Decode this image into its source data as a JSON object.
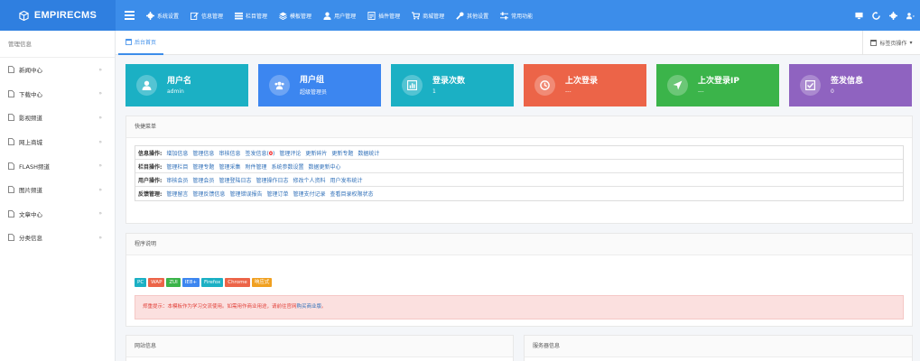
{
  "app": {
    "logo": "EMPIRECMS"
  },
  "nav": [
    {
      "label": "系统设置",
      "icon": "gear-icon"
    },
    {
      "label": "信息管理",
      "icon": "edit-icon"
    },
    {
      "label": "栏目管理",
      "icon": "list-icon"
    },
    {
      "label": "模板管理",
      "icon": "layers-icon"
    },
    {
      "label": "用户管理",
      "icon": "user-icon"
    },
    {
      "label": "插件管理",
      "icon": "plugin-icon"
    },
    {
      "label": "商城管理",
      "icon": "cart-icon"
    },
    {
      "label": "其他设置",
      "icon": "wrench-icon"
    },
    {
      "label": "常用功能",
      "icon": "sliders-icon"
    }
  ],
  "sidebar": {
    "title": "管理信息",
    "items": [
      {
        "label": "新闻中心"
      },
      {
        "label": "下载中心"
      },
      {
        "label": "影视频道"
      },
      {
        "label": "网上商城"
      },
      {
        "label": "FLASH频道"
      },
      {
        "label": "图片频道"
      },
      {
        "label": "文章中心"
      },
      {
        "label": "分类信息"
      }
    ]
  },
  "tabs": {
    "home": "后台首页",
    "ops": "标签页操作"
  },
  "cards": [
    {
      "title": "用户名",
      "value": "admin",
      "color": "#1bb0c4",
      "icon": "user-icon"
    },
    {
      "title": "用户组",
      "value": "超级管理员",
      "color": "#3c86f0",
      "icon": "users-icon"
    },
    {
      "title": "登录次数",
      "value": "1",
      "color": "#1bb0c4",
      "icon": "chart-icon"
    },
    {
      "title": "上次登录",
      "value": "---",
      "color": "#ec6448",
      "icon": "clock-icon"
    },
    {
      "title": "上次登录IP",
      "value": "---",
      "color": "#3bb44a",
      "icon": "location-arrow-icon"
    },
    {
      "title": "签发信息",
      "value": "0",
      "color": "#8f63c0",
      "icon": "checkbox-icon"
    }
  ],
  "quick_menu": {
    "title": "快捷菜单",
    "rows": [
      {
        "label": "信息操作:",
        "links": [
          "增加信息",
          "管理信息",
          "审核信息",
          "签发信息",
          "管理评论",
          "更新碎片",
          "更新专题",
          "数据统计"
        ],
        "signed_count": "0"
      },
      {
        "label": "栏目操作:",
        "links": [
          "管理栏目",
          "管理专题",
          "管理采集",
          "附件管理",
          "系统参数设置",
          "数据更新中心"
        ]
      },
      {
        "label": "用户操作:",
        "links": [
          "审核会员",
          "管理会员",
          "管理登陆日志",
          "管理操作日志",
          "修改个人资料",
          "用户发布统计"
        ]
      },
      {
        "label": "反馈管理:",
        "links": [
          "管理留言",
          "管理反馈信息",
          "管理错误报告",
          "管理订单",
          "管理支付记录",
          "查看目录权限状态"
        ]
      }
    ]
  },
  "program": {
    "title": "程序说明",
    "badges": [
      {
        "text": "PC",
        "color": "#1bb0c4"
      },
      {
        "text": "WAP",
        "color": "#ec6448"
      },
      {
        "text": "ZUI",
        "color": "#3bb44a"
      },
      {
        "text": "IE8+",
        "color": "#3c86f0"
      },
      {
        "text": "Firefox",
        "color": "#1bb0c4"
      },
      {
        "text": "Chrome",
        "color": "#ec6448"
      },
      {
        "text": "响应式",
        "color": "#f0a020"
      }
    ],
    "notice_prefix": "郑重提示：本模板作为学习交流使用。如需用作商业用途，请前往官网",
    "notice_link": "购买商业版",
    "notice_suffix": "。"
  },
  "site_info": {
    "title": "网站信息"
  },
  "server_info": {
    "title": "服务器信息"
  }
}
